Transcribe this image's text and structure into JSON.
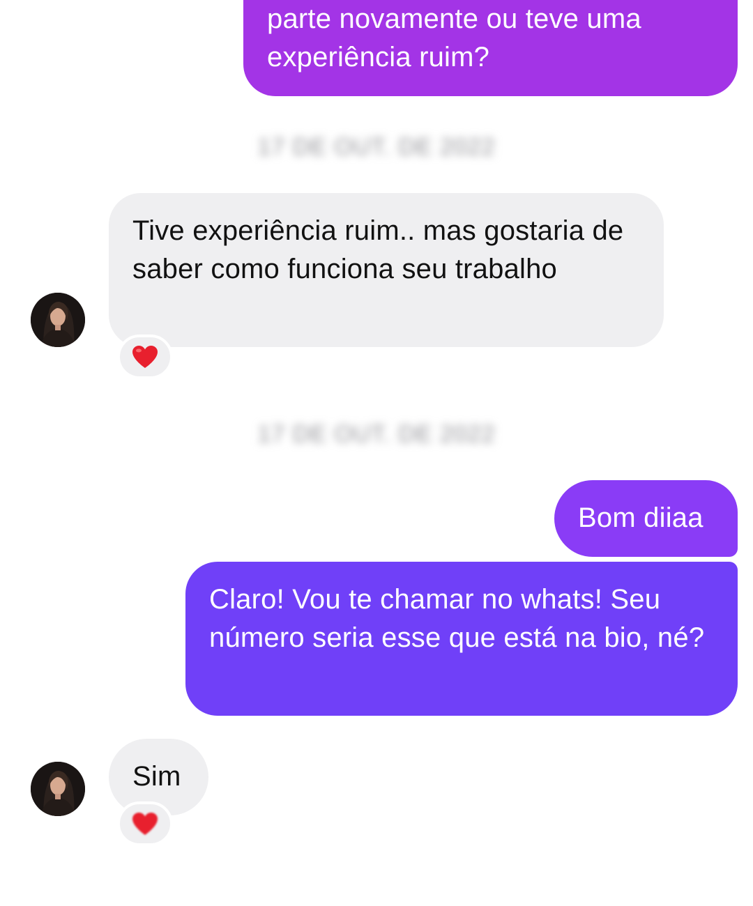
{
  "colors": {
    "outgoing_top": "#a334e6",
    "outgoing_mid": "#8a3cf6",
    "outgoing_bottom": "#7040f8",
    "incoming": "#efeff1",
    "reaction_heart": "#e8202e"
  },
  "messages": [
    {
      "direction": "outgoing",
      "text": "parte novamente ou teve uma experiência ruim?"
    },
    {
      "direction": "incoming",
      "text": "Tive experiência ruim.. mas gostaria de saber como funciona seu trabalho",
      "reaction": "heart-icon"
    },
    {
      "direction": "outgoing",
      "text": "Bom diiaa"
    },
    {
      "direction": "outgoing",
      "text": "Claro! Vou te chamar no whats! Seu número seria esse que está na bio, né?"
    },
    {
      "direction": "incoming",
      "text": "Sim",
      "reaction": "heart-icon"
    }
  ],
  "timestamps": [
    "17 DE OUT. DE 2022",
    "17 DE OUT. DE 2022"
  ],
  "avatar": {
    "icon": "user-avatar-photo"
  }
}
